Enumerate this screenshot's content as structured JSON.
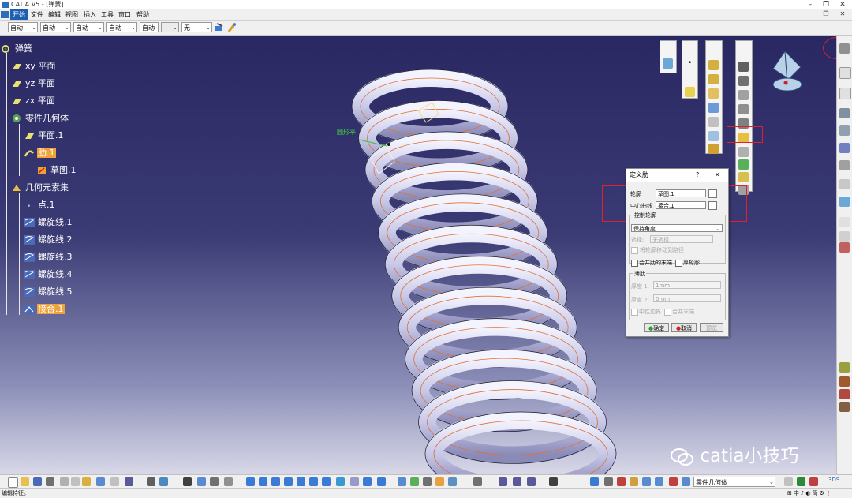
{
  "window": {
    "title": "CATIA V5 - [弹簧]"
  },
  "menu": [
    "开始",
    "文件",
    "编辑",
    "视图",
    "插入",
    "工具",
    "窗口",
    "帮助"
  ],
  "combos": [
    "自动",
    "自动",
    "自动",
    "自动",
    "自动",
    "",
    "无"
  ],
  "tree": {
    "root": "弹簧",
    "xy": "xy 平面",
    "yz": "yz 平面",
    "zx": "zx 平面",
    "body": "零件几何体",
    "plane1": "平面.1",
    "rib1": "肋.1",
    "sketch1": "草图.1",
    "geoset": "几何元素集",
    "point1": "点.1",
    "helix1": "螺旋线.1",
    "helix2": "螺旋线.2",
    "helix3": "螺旋线.3",
    "helix4": "螺旋线.4",
    "helix5": "螺旋线.5",
    "join1": "接合.1"
  },
  "viewport": {
    "tag": "圆形平"
  },
  "dialog": {
    "title": "定义肋",
    "help": "?",
    "close": "✕",
    "profile_label": "轮廓",
    "profile_value": "草图.1",
    "center_label": "中心曲线",
    "center_value": "接合.1",
    "control_group": "控制轮廓",
    "control_value": "保持角度",
    "select_label": "选择:",
    "select_value": "无选择",
    "project_label": "将轮廓移动到路径",
    "merge_label": "合并肋的末端",
    "thick_label": "厚轮廓",
    "thin_group": "薄肋",
    "t1_label": "厚度 1:",
    "t1_value": "1mm",
    "t2_label": "厚度 2:",
    "t2_value": "0mm",
    "neutral_label": "中性边界",
    "merge_end_label": "合并末端",
    "ok": "确定",
    "cancel": "取消",
    "preview": "预览"
  },
  "bottom": {
    "combo": "零件几何体"
  },
  "status": {
    "text": "编辑特征。"
  },
  "watermark": {
    "text": "catia小技巧"
  },
  "colors": {
    "accent": "#1d5fb0",
    "highlight": "#f0a23a",
    "redbox": "#e0202a"
  }
}
